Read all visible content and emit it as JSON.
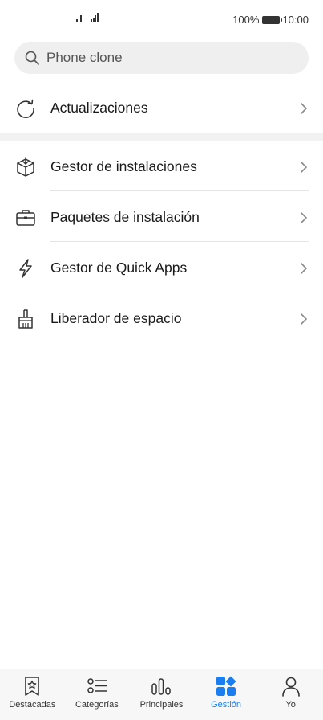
{
  "status_bar": {
    "battery_text": "100%",
    "time": "10:00"
  },
  "search": {
    "placeholder": "Phone clone"
  },
  "menu": {
    "updates": {
      "label": "Actualizaciones",
      "icon": "refresh-icon"
    },
    "items": [
      {
        "label": "Gestor de instalaciones",
        "icon": "box-download-icon"
      },
      {
        "label": "Paquetes de instalación",
        "icon": "briefcase-icon"
      },
      {
        "label": "Gestor de Quick Apps",
        "icon": "lightning-icon"
      },
      {
        "label": "Liberador de espacio",
        "icon": "broom-icon"
      }
    ]
  },
  "bottom_nav": {
    "active_color": "#1a7ef0",
    "items": [
      {
        "label": "Destacadas",
        "icon": "star-bookmark-icon",
        "active": false
      },
      {
        "label": "Categorías",
        "icon": "list-icon",
        "active": false
      },
      {
        "label": "Principales",
        "icon": "bar-chart-icon",
        "active": false
      },
      {
        "label": "Gestión",
        "icon": "grid-icon",
        "active": true
      },
      {
        "label": "Yo",
        "icon": "person-icon",
        "active": false
      }
    ]
  }
}
